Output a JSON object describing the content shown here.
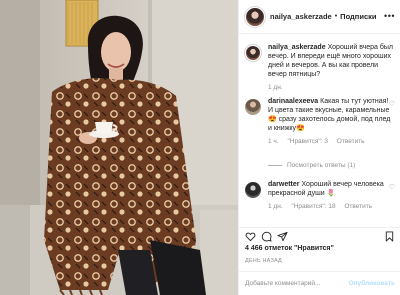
{
  "post": {
    "author": "nailya_askerzade",
    "separator": "•",
    "follow_label": "Подписки",
    "more_label": "•••"
  },
  "caption": {
    "username": "nailya_askerzade",
    "text": "Хороший вчера был вечер. И впереди ещё много хороших дней и вечеров. А вы как провели вечер пятницы?",
    "time": "1 дн."
  },
  "comments": [
    {
      "username": "darinaalexeeva",
      "text": "Какая ты тут уютная! И цвета такие вкусные, карамельные 😍 сразу захотелось домой, под плед и книжку😍",
      "time": "1 ч.",
      "likes": "\"Нравится\": 3",
      "reply": "Ответить",
      "view_replies": "Посмотреть ответы (1)"
    },
    {
      "username": "darwetter",
      "text": "Хороший вечер человека прекрасной души 🌷",
      "time": "1 дн.",
      "likes": "\"Нравится\": 18",
      "reply": "Ответить"
    }
  ],
  "stats": {
    "likes_count": "4 466",
    "likes_label": "отметок \"Нравится\"",
    "date": "ДЕНЬ НАЗАД"
  },
  "add_comment": {
    "placeholder": "Добавьте комментарий...",
    "post_label": "Опубликовать"
  },
  "colors": {
    "text": "#262626",
    "secondary": "#8e8e8e",
    "border": "#efefef",
    "post_button": "#b2dffc"
  },
  "icons": [
    "heart-icon",
    "comment-icon",
    "share-icon",
    "bookmark-icon",
    "more-icon"
  ]
}
